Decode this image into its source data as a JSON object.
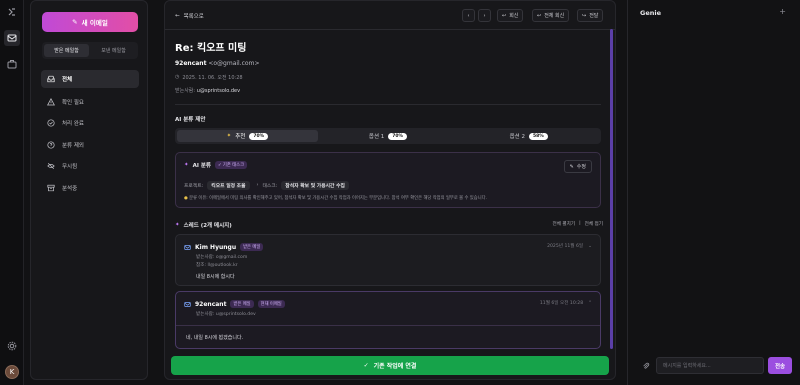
{
  "rail": {
    "avatar_letter": "K"
  },
  "sidebar": {
    "new_mail_label": "새 이메일",
    "tabs": [
      {
        "label": "받은 메일함",
        "active": true
      },
      {
        "label": "보낸 메일함",
        "active": false
      }
    ],
    "items": [
      {
        "label": "전체",
        "icon": "inbox-icon",
        "active": true
      },
      {
        "label": "확인 필요",
        "icon": "warning-icon",
        "active": false
      },
      {
        "label": "처리 완료",
        "icon": "check-circle-icon",
        "active": false
      },
      {
        "label": "분류 제외",
        "icon": "help-circle-icon",
        "active": false
      },
      {
        "label": "무시됨",
        "icon": "eye-off-icon",
        "active": false
      },
      {
        "label": "분석중",
        "icon": "archive-icon",
        "active": false
      }
    ]
  },
  "toolbar": {
    "back_label": "목록으로",
    "reply_label": "회신",
    "reply_all_label": "전체 회신",
    "forward_label": "전달"
  },
  "email": {
    "subject": "Re: 킥오프 미팅",
    "sender_name": "92encant",
    "sender_email": "<o@gmail.com>",
    "date": "2025. 11. 06. 오전 10:28",
    "recipient_label": "받는사람:",
    "recipient_value": "u@sprintsolo.dev"
  },
  "ai": {
    "section_title": "AI 분류 제안",
    "options": [
      {
        "label": "추천",
        "pct": "70%",
        "active": true
      },
      {
        "label": "옵션 1",
        "pct": "70%",
        "active": false
      },
      {
        "label": "옵션 2",
        "pct": "58%",
        "active": false
      }
    ],
    "card_title": "AI 분류",
    "card_badge": "기존 태스크",
    "edit_label": "수정",
    "project_label": "프로젝트:",
    "project_value": "킥오프 일정 조율",
    "task_label": "태스크:",
    "task_value": "참석자 확보 및 가용시간 수집",
    "reason": "분류 이유: 이메일에서 미팅 의사를 확인해주고 있어, 참석자 확보 및 가용시간 수집 작업과 이어지는 부분입니다. 참석 여부 확인은 해당 작업의 일부로 볼 수 있습니다."
  },
  "thread": {
    "title": "스레드 (2개 메시지)",
    "expand_all": "전체 펼치기",
    "collapse_all": "전체 접기",
    "messages": [
      {
        "sender": "Kim Hyungu",
        "tag": "받은 메일",
        "from": "받는사람: o@gmail.com",
        "cc": "참조: ll@outlook.kr",
        "time": "2025년 11월 6일",
        "body": "내일 8시에 합시다"
      },
      {
        "sender": "92encant",
        "tag": "받은 메일",
        "tag2": "현재 이메일",
        "from": "받는사람: u@sprintsolo.dev",
        "time": "11월 6일 오전 10:28",
        "body": "네, 내일 8시에 뵙겠습니다."
      }
    ]
  },
  "link_button_label": "기존 작업에 연결",
  "genie": {
    "title": "Genie",
    "input_placeholder": "메시지를 입력하세요...",
    "send_label": "전송"
  },
  "colors": {
    "accent_gradient_start": "#c04ad6",
    "accent_gradient_end": "#e24ea6",
    "confirm_green": "#16a34a",
    "send_purple": "#9b4ee0"
  }
}
